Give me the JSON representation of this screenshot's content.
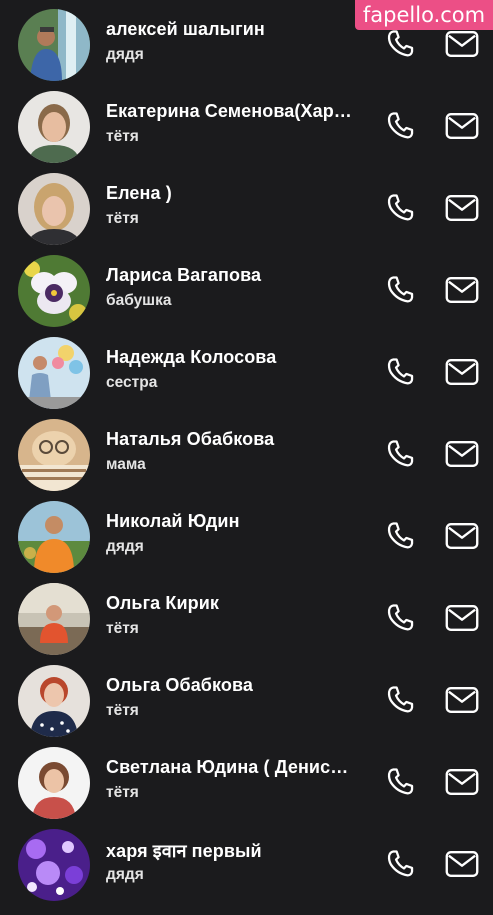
{
  "contacts": [
    {
      "name": "алексей шалыгин",
      "relation": "дядя",
      "avatar": "avatar-photo-man-waterfall"
    },
    {
      "name": "Екатерина Семенова(Хар…",
      "relation": "тётя",
      "avatar": "avatar-photo-woman"
    },
    {
      "name": "Елена )",
      "relation": "тётя",
      "avatar": "avatar-photo-woman-blonde"
    },
    {
      "name": "Лариса Вагапова",
      "relation": "бабушка",
      "avatar": "avatar-photo-pansy-flower"
    },
    {
      "name": "Надежда Колосова",
      "relation": "сестра",
      "avatar": "avatar-photo-people-balloons"
    },
    {
      "name": "Наталья Обабкова",
      "relation": "мама",
      "avatar": "avatar-photo-cat-cake"
    },
    {
      "name": "Николай Юдин",
      "relation": "дядя",
      "avatar": "avatar-photo-man-orange"
    },
    {
      "name": "Ольга Кирик",
      "relation": "тётя",
      "avatar": "avatar-photo-woman-outdoor"
    },
    {
      "name": "Ольга Обабкова",
      "relation": "тётя",
      "avatar": "avatar-photo-woman-redhead"
    },
    {
      "name": "Светлана Юдина ( Денис…",
      "relation": "тётя",
      "avatar": "avatar-photo-woman-white-bg"
    },
    {
      "name": "харя इवान первый",
      "relation": "дядя",
      "avatar": "avatar-photo-purple-lights"
    }
  ],
  "actions": {
    "call_icon": "phone-icon",
    "message_icon": "mail-icon"
  },
  "watermark": {
    "text": "fapello.com"
  },
  "colors": {
    "background": "#1b1b1d",
    "text": "#ffffff",
    "watermark_bg": "#ec4f86"
  }
}
